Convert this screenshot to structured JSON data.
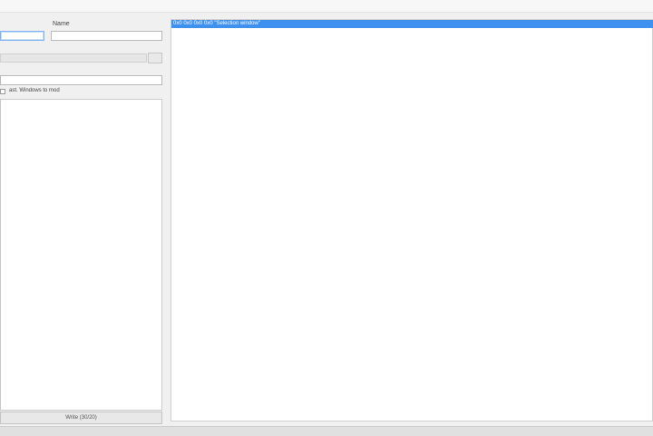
{
  "window": {
    "title": ""
  },
  "form": {
    "name_label": "Name",
    "first_field_value": "",
    "name_field_value": "",
    "path_field_value": "",
    "checkbox_label": "ast. Windows to mod",
    "checkbox_checked": false
  },
  "buttons": {
    "bottom_label": "Write (30/20)"
  },
  "output": {
    "selected_row_text": "0x0 0x0 0x0 0x0  \"Selection window\""
  },
  "colors": {
    "selection": "#3f91ef",
    "background": "#f0f0f0"
  }
}
